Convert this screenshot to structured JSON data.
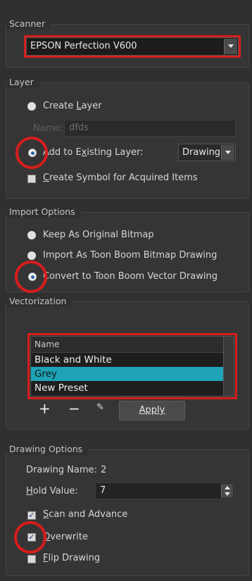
{
  "scanner": {
    "legend": "Scanner",
    "device_value": "EPSON Perfection V600"
  },
  "layer": {
    "legend": "Layer",
    "create_layer": "Create Layer",
    "name_label": "Name:",
    "name_value": "dfds",
    "add_existing": "Add to Existing Layer:",
    "existing_value": "Drawing",
    "create_symbol": "Create Symbol for Acquired Items"
  },
  "import_options": {
    "legend": "Import Options",
    "keep_original": "Keep As Original Bitmap",
    "import_toon": "Import As Toon Boom Bitmap Drawing",
    "convert_vector": "Convert to Toon Boom Vector Drawing"
  },
  "vectorization": {
    "legend": "Vectorization",
    "column_header": "Name",
    "presets": [
      "Black and White",
      "Grey",
      "New Preset"
    ],
    "selected_index": 1,
    "add_label": "+",
    "remove_label": "−",
    "apply_label": "Apply"
  },
  "drawing_options": {
    "legend": "Drawing Options",
    "drawing_name_label": "Drawing Name:",
    "drawing_name_value": "2",
    "hold_value_label": "Hold Value:",
    "hold_value": "7",
    "scan_advance": "Scan and Advance",
    "overwrite": "Overwrite",
    "flip_drawing": "Flip Drawing"
  },
  "colors": {
    "highlight": "#d51d1d",
    "selection": "#1ea4b6",
    "background": "#303030"
  }
}
